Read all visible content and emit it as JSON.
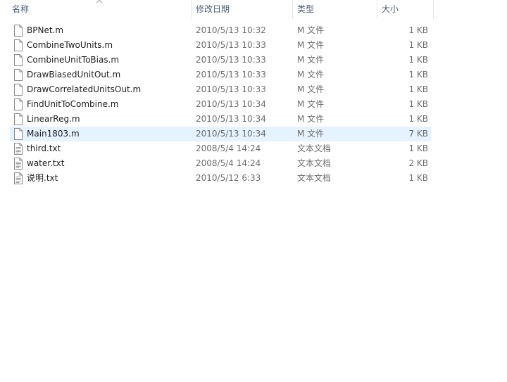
{
  "header": {
    "name": "名称",
    "date": "修改日期",
    "type": "类型",
    "size": "大小"
  },
  "icons": {
    "sort": "chevron-up-icon",
    "file": "file-icon",
    "text_file": "text-document-icon"
  },
  "colors": {
    "header_text": "#4c607a",
    "selected_row": "#e5f3ff",
    "meta_text": "#6d6d6d"
  },
  "files": [
    {
      "name": "BPNet.m",
      "date": "2010/5/13 10:32",
      "type": "M 文件",
      "size": "1 KB",
      "kind": "m"
    },
    {
      "name": "CombineTwoUnits.m",
      "date": "2010/5/13 10:33",
      "type": "M 文件",
      "size": "1 KB",
      "kind": "m"
    },
    {
      "name": "CombineUnitToBias.m",
      "date": "2010/5/13 10:33",
      "type": "M 文件",
      "size": "1 KB",
      "kind": "m"
    },
    {
      "name": "DrawBiasedUnitOut.m",
      "date": "2010/5/13 10:33",
      "type": "M 文件",
      "size": "1 KB",
      "kind": "m"
    },
    {
      "name": "DrawCorrelatedUnitsOut.m",
      "date": "2010/5/13 10:33",
      "type": "M 文件",
      "size": "1 KB",
      "kind": "m"
    },
    {
      "name": "FindUnitToCombine.m",
      "date": "2010/5/13 10:34",
      "type": "M 文件",
      "size": "1 KB",
      "kind": "m"
    },
    {
      "name": "LinearReg.m",
      "date": "2010/5/13 10:34",
      "type": "M 文件",
      "size": "1 KB",
      "kind": "m"
    },
    {
      "name": "Main1803.m",
      "date": "2010/5/13 10:34",
      "type": "M 文件",
      "size": "7 KB",
      "kind": "m",
      "selected": true
    },
    {
      "name": "third.txt",
      "date": "2008/5/4 14:24",
      "type": "文本文档",
      "size": "1 KB",
      "kind": "txt"
    },
    {
      "name": "water.txt",
      "date": "2008/5/4 14:24",
      "type": "文本文档",
      "size": "2 KB",
      "kind": "txt"
    },
    {
      "name": "说明.txt",
      "date": "2010/5/12 6:33",
      "type": "文本文档",
      "size": "1 KB",
      "kind": "txt"
    }
  ]
}
